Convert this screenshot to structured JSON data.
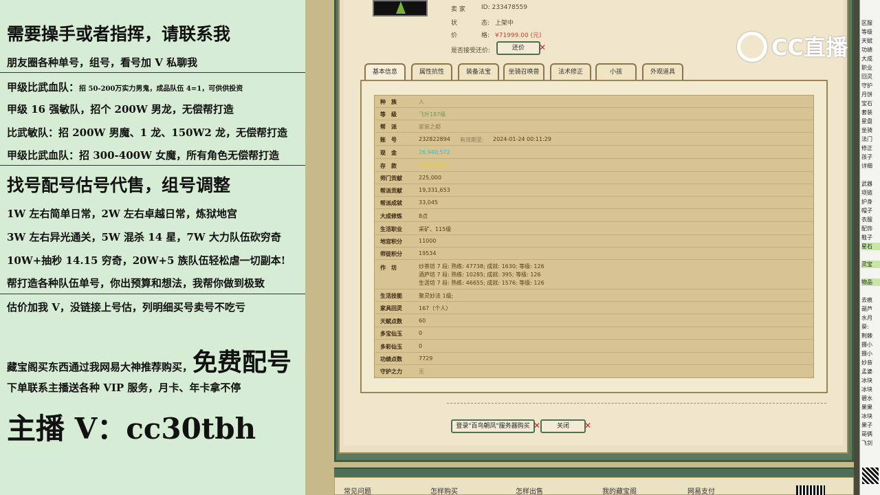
{
  "overlay": {
    "line1": "需要操手或者指挥，请联系我",
    "line2": "朋友圈各种单号，组号，看号加 V 私聊我",
    "line3a": "甲级比武血队：",
    "line3b": "招 50-200万实力男鬼，成品队伍 4=1，可供供投资",
    "line4": "甲级 16 强敏队，招个 200W 男龙，无偿帮打造",
    "line5": "比武敏队：招 200W 男魔、1 龙、150W2 龙，无偿帮打造",
    "line6": "甲级比武血队：招 300-400W 女魔，所有角色无偿帮打造",
    "line7": "找号配号估号代售，组号调整",
    "line8": "1W 左右简单日常，2W 左右卓越日常，炼狱地宫",
    "line9": "3W 左右异光通关，5W 混杀 14 星，7W 大力队伍砍穷奇",
    "line10": "10W+抽秒 14.15 穷奇，20W+5 族队伍轻松虐一切副本!",
    "line11": "帮打造各种队伍单号，你出预算和想法，我帮你做到极致",
    "line12": "估价加我 V，没链接上号估，列明细买号卖号不吃亏",
    "line13a": "藏宝阁买东西通过我网易大神推荐购买，",
    "line13b": "免费配号",
    "line14": "下单联系主播送各种 VIP 服务，月卡、年卡拿不停",
    "line15": "主播 V：cc30tbh"
  },
  "seller": {
    "seller_label": "卖 家",
    "seller_id": "ID:  233478559",
    "status_label": "状",
    "status_label2": "态:",
    "status_value": "上架中",
    "price_label": "价",
    "price_label2": "格:",
    "price_value": "¥71999.00 (元)",
    "bargain_label": "是否接受还价:",
    "bargain_button": "还价"
  },
  "tabs": [
    "基本信息",
    "属性抗性",
    "装备法宝",
    "坐骑召唤兽",
    "法术修正",
    "小孩",
    "外观道具"
  ],
  "details": {
    "race_k": "种　族",
    "race_v": "人",
    "level_k": "等　级",
    "level_v": "飞升187级",
    "sect_k": "帮　派",
    "sect_v": "家装之都",
    "acct_k": "账　号",
    "acct_v": "232822894",
    "acct_valid": "有效期至:",
    "acct_date": "2024-01-24 00:11:29",
    "cash_k": "现　金",
    "cash_v": "26,940,572",
    "deposit_k": "存　款",
    "deposit_v": "4,500,000",
    "shimen_k": "师门贡献",
    "shimen_v": "225,000",
    "bangpai_k": "帮派贡献",
    "bangpai_v": "19,331,653",
    "bangji_k": "帮派成就",
    "bangji_v": "33,045",
    "dacheng_k": "大成修炼",
    "dacheng_v": "8点",
    "life_k": "生活职业",
    "life_v": "采矿、115级",
    "digong_k": "地宫积分",
    "digong_v": "11000",
    "shitu_k": "师徒积分",
    "shitu_v": "19534",
    "workshop_k": "作　坊",
    "ws1": "炒茶坊 7 段:  熟练:  47738;  成就:  1630;  等级:  126",
    "ws2": "酒庐坊 7 段:  熟练:  10285;  成就:  395;  等级:  126",
    "ws3": "生涯坊 7 段:  熟练:  46655;  成就:  1576;  等级:  126",
    "skill_k": "生活技能",
    "skill_v": "聚灵妙法 1级;",
    "family_k": "家具回灵",
    "family_v": "167（个人）",
    "talent_k": "天赋点数",
    "talent_v": "60",
    "duobao_k": "多宝仙玉",
    "duobao_v": "0",
    "duocai_k": "多彩仙玉",
    "duocai_v": "0",
    "gongji_k": "功绩点数",
    "gongji_v": "7729",
    "shouhu_k": "守护之力",
    "shouhu_v": "无"
  },
  "actions": {
    "login_buy": "登录\"百鸟朝凤\"服务器购买",
    "close": "关闭",
    "x_mark": "✕"
  },
  "footer": {
    "faq": "常见问题",
    "how_buy": "怎样购买",
    "how_sell": "怎样出售",
    "my_tbg": "我的藏宝阁",
    "netease_pay": "网易支付"
  },
  "right_list": [
    "区服",
    "等级",
    "天赋",
    "功绩",
    "大成",
    "职业",
    "回灵",
    "守护",
    "月饼",
    "宝石",
    "套装",
    "星盘",
    "坐骑",
    "法门",
    "修正",
    "孩子",
    "详细",
    "",
    "武器",
    "项链",
    "护身",
    "帽子",
    "衣服",
    "配饰",
    "鞋子",
    "星石",
    "",
    "灵宝",
    "",
    "物品",
    "",
    "去痕",
    "葫芦",
    "水月",
    "葵:",
    "荆棘",
    "摄小",
    "摄小",
    "妙音",
    "孟婆",
    "冰块",
    "冰块",
    "碧水",
    "果果",
    "冰块",
    "果子",
    "哥俩",
    "飞剑"
  ],
  "watermark": "CC直播",
  "colors": {
    "accent_green": "#4f6f53",
    "price_red": "#cc4433",
    "cash_cyan": "#3ab8c8",
    "deposit_yellow": "#e8d030"
  }
}
